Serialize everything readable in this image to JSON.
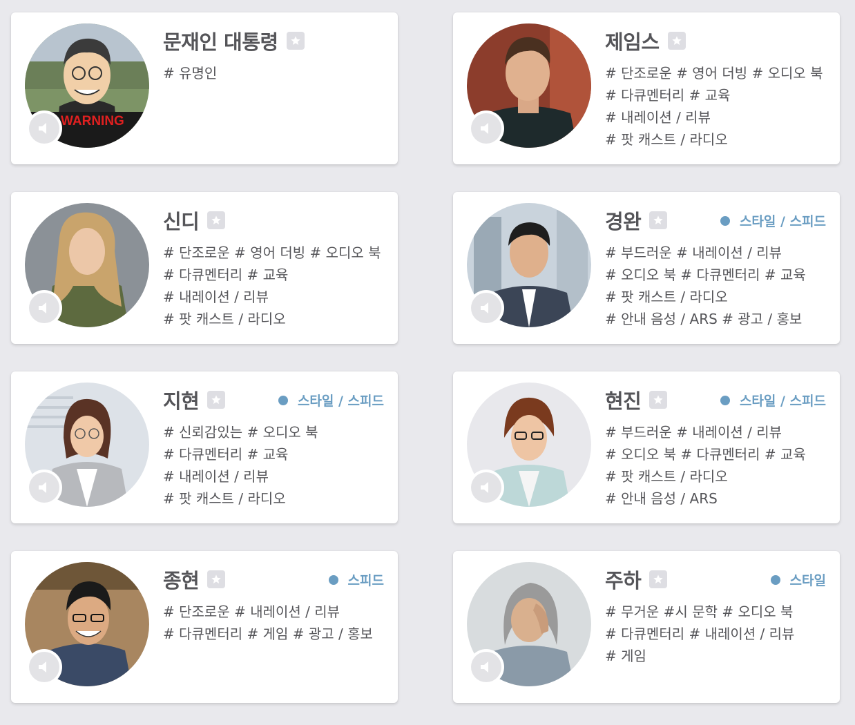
{
  "accent_color": "#6a9dc2",
  "voices": [
    {
      "name": "문재인 대통령",
      "tags": [
        "# 유명인"
      ],
      "avatar_overlay_text": "WARNING"
    },
    {
      "name": "제임스",
      "tags": [
        "# 단조로운 # 영어 더빙 # 오디오 북",
        "# 다큐멘터리 # 교육",
        "# 내레이션 / 리뷰",
        "# 팟 캐스트 / 라디오"
      ]
    },
    {
      "name": "신디",
      "tags": [
        "# 단조로운 # 영어 더빙 # 오디오 북",
        "# 다큐멘터리 # 교육",
        "# 내레이션 / 리뷰",
        "# 팟 캐스트 / 라디오"
      ]
    },
    {
      "name": "경완",
      "badge": "스타일 / 스피드",
      "tags": [
        "# 부드러운 # 내레이션 / 리뷰",
        "# 오디오 북 # 다큐멘터리 # 교육",
        "# 팟 캐스트 / 라디오",
        "# 안내 음성 / ARS # 광고 / 홍보"
      ]
    },
    {
      "name": "지현",
      "badge": "스타일 / 스피드",
      "tags": [
        "# 신뢰감있는 # 오디오 북",
        "# 다큐멘터리 # 교육",
        "# 내레이션 / 리뷰",
        "# 팟 캐스트 / 라디오"
      ]
    },
    {
      "name": "현진",
      "badge": "스타일 / 스피드",
      "tags": [
        "# 부드러운 # 내레이션 / 리뷰",
        "# 오디오 북 # 다큐멘터리 # 교육",
        "# 팟 캐스트 / 라디오",
        "# 안내 음성 / ARS"
      ]
    },
    {
      "name": "종현",
      "badge": "스피드",
      "tags": [
        "# 단조로운 # 내레이션 / 리뷰",
        "# 다큐멘터리 # 게임 # 광고 / 홍보"
      ]
    },
    {
      "name": "주하",
      "badge": "스타일",
      "tags": [
        "# 무거운 #시 문학 # 오디오 북",
        "# 다큐멘터리 # 내레이션 / 리뷰",
        "# 게임"
      ]
    }
  ]
}
